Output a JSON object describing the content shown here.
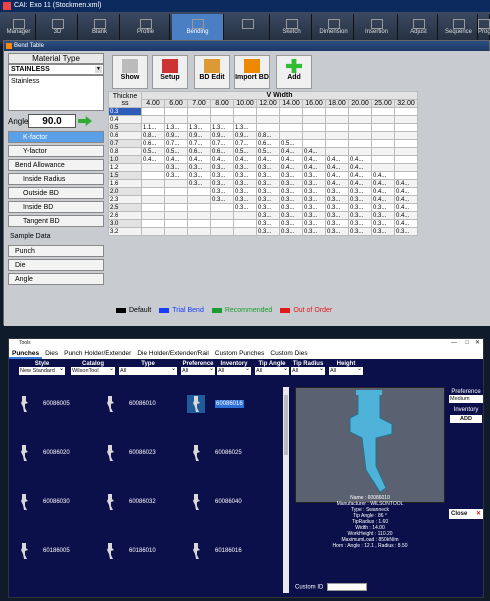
{
  "app": {
    "title": "CAI: Exo 11 (Stockmen.xml)",
    "ribbon_tabs": [
      "Manager",
      "3D",
      "Blank",
      "Profile",
      "Bending",
      "",
      "Sketch",
      "Dimension",
      "Insertion",
      "Adjust",
      "Sequence",
      "Prog"
    ]
  },
  "bend_table": {
    "window_title": "Bend Table",
    "material_header": "Material Type",
    "material_selected": "STAINLESS",
    "material_list": [
      "Stainless"
    ],
    "angle_label": "Angle",
    "angle_value": "90.0",
    "nav_buttons": [
      "K-factor",
      "Y-factor",
      "Bend Allowance",
      "Inside Radius",
      "Outside BD",
      "Inside BD",
      "Tangent BD"
    ],
    "sample_data_label": "Sample Data",
    "sample_buttons": [
      "Punch",
      "Die",
      "Angle"
    ],
    "toolbar": [
      {
        "label": "Show",
        "icon": "show-icon"
      },
      {
        "label": "Setup",
        "icon": "setup-icon"
      },
      {
        "label": "BD Edit",
        "icon": "bd-edit-icon"
      },
      {
        "label": "Import BD",
        "icon": "import-icon"
      },
      {
        "label": "Add",
        "icon": "add-icon"
      }
    ],
    "v_width_header": "V Width",
    "thickness_header": "Thickne ss",
    "v_widths": [
      "4.00",
      "6.00",
      "7.00",
      "8.00",
      "10.00",
      "12.00",
      "14.00",
      "16.00",
      "18.00",
      "20.00",
      "25.00",
      "32.00"
    ],
    "rows": [
      {
        "t": "0.3",
        "sel": true,
        "c": [
          "",
          "",
          "",
          "",
          "",
          "",
          "",
          "",
          "",
          "",
          "",
          ""
        ]
      },
      {
        "t": "0.4",
        "c": [
          "",
          "",
          "",
          "",
          "",
          "",
          "",
          "",
          "",
          "",
          "",
          ""
        ]
      },
      {
        "t": "0.5",
        "c": [
          "1.1...",
          "1.3...",
          "1.3...",
          "1.3...",
          "1.3...",
          "",
          "",
          "",
          "",
          "",
          "",
          ""
        ]
      },
      {
        "t": "0.6",
        "c": [
          "0.8...",
          "0.9...",
          "0.9...",
          "0.9...",
          "0.9...",
          "0.8...",
          "",
          "",
          "",
          "",
          "",
          ""
        ]
      },
      {
        "t": "0.7",
        "c": [
          "0.6...",
          "0.7...",
          "0.7...",
          "0.7...",
          "0.7...",
          "0.6...",
          "0.5...",
          "",
          "",
          "",
          "",
          ""
        ]
      },
      {
        "t": "0.8",
        "c": [
          "0.5...",
          "0.5...",
          "0.6...",
          "0.6...",
          "0.5...",
          "0.5...",
          "0.4...",
          "0.4...",
          "",
          "",
          "",
          ""
        ]
      },
      {
        "t": "1.0",
        "c": [
          "0.4...",
          "0.4...",
          "0.4...",
          "0.4...",
          "0.4...",
          "0.4...",
          "0.4...",
          "0.4...",
          "0.4...",
          "0.4...",
          "",
          ""
        ]
      },
      {
        "t": "1.2",
        "c": [
          "",
          "0.3...",
          "0.3...",
          "0.3...",
          "0.3...",
          "0.3...",
          "0.4...",
          "0.4...",
          "0.4...",
          "0.4...",
          "",
          ""
        ]
      },
      {
        "t": "1.5",
        "c": [
          "",
          "0.3...",
          "0.3...",
          "0.3...",
          "0.3...",
          "0.3...",
          "0.3...",
          "0.3...",
          "0.4...",
          "0.4...",
          "0.4...",
          ""
        ]
      },
      {
        "t": "1.6",
        "c": [
          "",
          "",
          "0.3...",
          "0.3...",
          "0.3...",
          "0.3...",
          "0.3...",
          "0.3...",
          "0.4...",
          "0.4...",
          "0.4...",
          "0.4..."
        ]
      },
      {
        "t": "2.0",
        "c": [
          "",
          "",
          "",
          "0.3...",
          "0.3...",
          "0.3...",
          "0.3...",
          "0.3...",
          "0.3...",
          "0.3...",
          "0.4...",
          "0.4..."
        ]
      },
      {
        "t": "2.3",
        "c": [
          "",
          "",
          "",
          "0.3...",
          "0.3...",
          "0.3...",
          "0.3...",
          "0.3...",
          "0.3...",
          "0.3...",
          "0.4...",
          "0.4..."
        ]
      },
      {
        "t": "2.5",
        "c": [
          "",
          "",
          "",
          "",
          "0.3...",
          "0.3...",
          "0.3...",
          "0.3...",
          "0.3...",
          "0.3...",
          "0.3...",
          "0.4..."
        ]
      },
      {
        "t": "2.6",
        "c": [
          "",
          "",
          "",
          "",
          "",
          "0.3...",
          "0.3...",
          "0.3...",
          "0.3...",
          "0.3...",
          "0.3...",
          "0.4..."
        ]
      },
      {
        "t": "3.0",
        "c": [
          "",
          "",
          "",
          "",
          "",
          "0.3...",
          "0.3...",
          "0.3...",
          "0.3...",
          "0.3...",
          "0.3...",
          "0.4..."
        ]
      },
      {
        "t": "3.2",
        "c": [
          "",
          "",
          "",
          "",
          "",
          "0.3...",
          "0.3...",
          "0.3...",
          "0.3...",
          "0.3...",
          "0.3...",
          "0.3..."
        ]
      }
    ],
    "legend": [
      {
        "label": "Default",
        "color": "#000000"
      },
      {
        "label": "Trial Bend",
        "color": "#1a3cff"
      },
      {
        "label": "Recommended",
        "color": "#1e9b2e"
      },
      {
        "label": "Out of Order",
        "color": "#e01818"
      }
    ]
  },
  "tools": {
    "window_title": "Tools",
    "tabs": [
      "Punches",
      "Dies",
      "Punch Holder/Extender",
      "Die Holder/Extender/Rail",
      "Custom Punches",
      "Custom Dies"
    ],
    "filters": [
      {
        "label": "Style",
        "value": "New Standard"
      },
      {
        "label": "Catalog",
        "value": "WilsonTool"
      },
      {
        "label": "Type",
        "value": "All"
      },
      {
        "label": "Preference",
        "value": "All"
      },
      {
        "label": "Inventory",
        "value": "All"
      },
      {
        "label": "Tip Angle",
        "value": "All"
      },
      {
        "label": "Tip Radius",
        "value": "All"
      },
      {
        "label": "Height",
        "value": "All"
      }
    ],
    "punches": [
      "60086005",
      "60086010",
      "60086016",
      "60086020",
      "60086023",
      "60086025",
      "60086030",
      "60086032",
      "60086040",
      "60186005",
      "60186010",
      "60186016"
    ],
    "selected_punch": "60086016",
    "details": [
      "Name : 60086010",
      "Manufacturer : WILSONTOOL",
      "Type : Swanneck",
      "Tip Angle : 86 °",
      "TipRadius : 1.60",
      "Width : 14.00",
      "WorkHeight : 110.20",
      "MaximumLoad : 850kN/m",
      "Horn : Angle : 12.1 , Radius : 8.50"
    ],
    "preference_label": "Preference",
    "preference_value": "Medium",
    "inventory_label": "Inventory",
    "add_label": "ADD",
    "close_label": "Close",
    "custom_id_label": "Custom ID"
  }
}
